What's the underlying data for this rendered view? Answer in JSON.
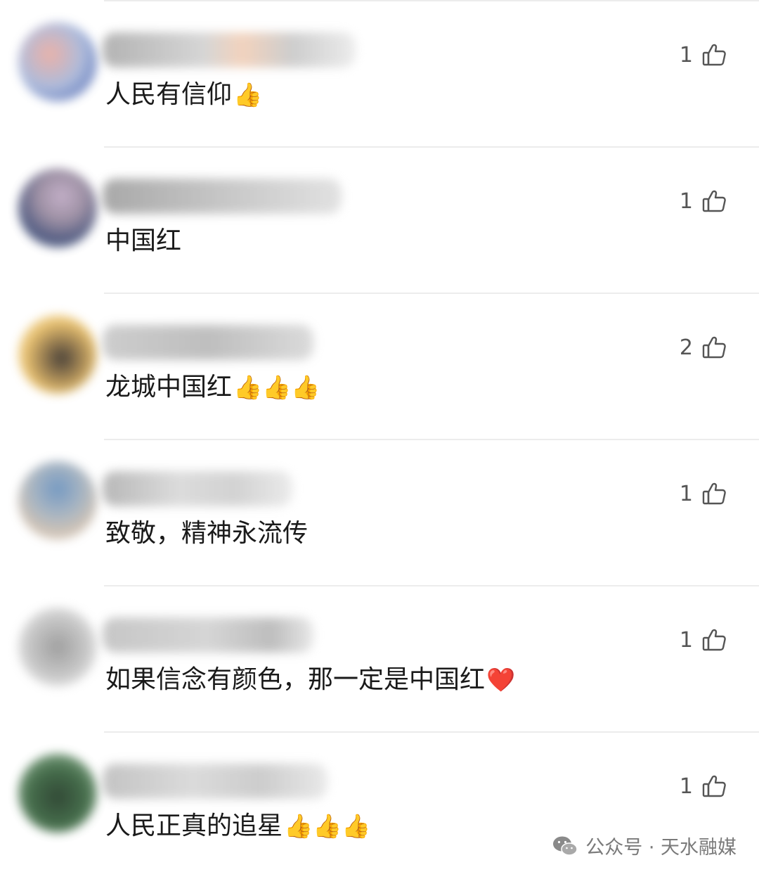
{
  "comments": [
    {
      "text": "人民有信仰",
      "emoji": "👍",
      "likes": "1"
    },
    {
      "text": "中国红",
      "emoji": "",
      "likes": "1"
    },
    {
      "text": "龙城中国红",
      "emoji": "👍👍👍",
      "likes": "2"
    },
    {
      "text": "致敬，精神永流传",
      "emoji": "",
      "likes": "1"
    },
    {
      "text": "如果信念有颜色，那一定是中国红",
      "emoji": "❤️",
      "likes": "1"
    },
    {
      "text": "人民正真的追星",
      "emoji": "👍👍👍",
      "likes": "1"
    }
  ],
  "watermark": {
    "text": "公众号 · 天水融媒"
  },
  "colors": {
    "text": "#1a1a1a",
    "like_icon": "#555555",
    "divider": "#ececec",
    "watermark": "#7a7a7a"
  },
  "icons": {
    "like": "thumbs-up-outline-icon",
    "watermark": "wechat-icon"
  }
}
